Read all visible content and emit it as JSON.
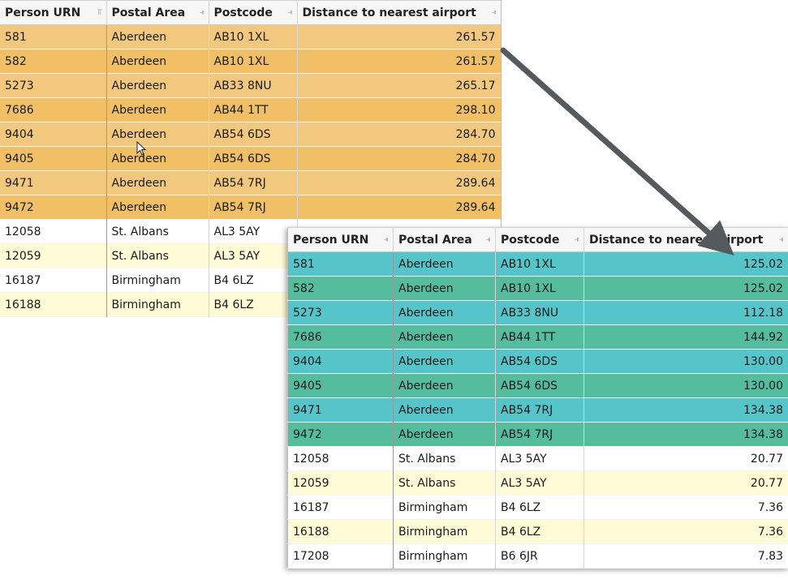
{
  "headers": {
    "person_urn": "Person URN",
    "postal_area": "Postal Area",
    "postcode": "Postcode",
    "distance": "Distance to nearest airport"
  },
  "colors": {
    "before_odd": "#f2c87f",
    "before_even": "#f0bf66",
    "after_odd": "#56c5c9",
    "after_even": "#55bd9d",
    "alt_plain": "#fffbd6",
    "plain": "#ffffff",
    "arrow": "#555a5e"
  },
  "before_table": {
    "rows": [
      {
        "urn": "581",
        "area": "Aberdeen",
        "postcode": "AB10 1XL",
        "distance": "261.57",
        "style": "hl"
      },
      {
        "urn": "582",
        "area": "Aberdeen",
        "postcode": "AB10 1XL",
        "distance": "261.57",
        "style": "hl"
      },
      {
        "urn": "5273",
        "area": "Aberdeen",
        "postcode": "AB33 8NU",
        "distance": "265.17",
        "style": "hl"
      },
      {
        "urn": "7686",
        "area": "Aberdeen",
        "postcode": "AB44 1TT",
        "distance": "298.10",
        "style": "hl"
      },
      {
        "urn": "9404",
        "area": "Aberdeen",
        "postcode": "AB54 6DS",
        "distance": "284.70",
        "style": "hl"
      },
      {
        "urn": "9405",
        "area": "Aberdeen",
        "postcode": "AB54 6DS",
        "distance": "284.70",
        "style": "hl"
      },
      {
        "urn": "9471",
        "area": "Aberdeen",
        "postcode": "AB54 7RJ",
        "distance": "289.64",
        "style": "hl"
      },
      {
        "urn": "9472",
        "area": "Aberdeen",
        "postcode": "AB54 7RJ",
        "distance": "289.64",
        "style": "hl"
      },
      {
        "urn": "12058",
        "area": "St. Albans",
        "postcode": "AL3 5AY",
        "distance": "",
        "style": "plain"
      },
      {
        "urn": "12059",
        "area": "St. Albans",
        "postcode": "AL3 5AY",
        "distance": "",
        "style": "alt"
      },
      {
        "urn": "16187",
        "area": "Birmingham",
        "postcode": "B4 6LZ",
        "distance": "",
        "style": "plain"
      },
      {
        "urn": "16188",
        "area": "Birmingham",
        "postcode": "B4 6LZ",
        "distance": "",
        "style": "alt"
      }
    ]
  },
  "after_table": {
    "rows": [
      {
        "urn": "581",
        "area": "Aberdeen",
        "postcode": "AB10 1XL",
        "distance": "125.02",
        "style": "hl"
      },
      {
        "urn": "582",
        "area": "Aberdeen",
        "postcode": "AB10 1XL",
        "distance": "125.02",
        "style": "hl"
      },
      {
        "urn": "5273",
        "area": "Aberdeen",
        "postcode": "AB33 8NU",
        "distance": "112.18",
        "style": "hl"
      },
      {
        "urn": "7686",
        "area": "Aberdeen",
        "postcode": "AB44 1TT",
        "distance": "144.92",
        "style": "hl"
      },
      {
        "urn": "9404",
        "area": "Aberdeen",
        "postcode": "AB54 6DS",
        "distance": "130.00",
        "style": "hl"
      },
      {
        "urn": "9405",
        "area": "Aberdeen",
        "postcode": "AB54 6DS",
        "distance": "130.00",
        "style": "hl"
      },
      {
        "urn": "9471",
        "area": "Aberdeen",
        "postcode": "AB54 7RJ",
        "distance": "134.38",
        "style": "hl"
      },
      {
        "urn": "9472",
        "area": "Aberdeen",
        "postcode": "AB54 7RJ",
        "distance": "134.38",
        "style": "hl"
      },
      {
        "urn": "12058",
        "area": "St. Albans",
        "postcode": "AL3 5AY",
        "distance": "20.77",
        "style": "plain"
      },
      {
        "urn": "12059",
        "area": "St. Albans",
        "postcode": "AL3 5AY",
        "distance": "20.77",
        "style": "alt"
      },
      {
        "urn": "16187",
        "area": "Birmingham",
        "postcode": "B4 6LZ",
        "distance": "7.36",
        "style": "plain"
      },
      {
        "urn": "16188",
        "area": "Birmingham",
        "postcode": "B4 6LZ",
        "distance": "7.36",
        "style": "alt"
      },
      {
        "urn": "17208",
        "area": "Birmingham",
        "postcode": "B6 6JR",
        "distance": "7.83",
        "style": "plain"
      }
    ]
  }
}
